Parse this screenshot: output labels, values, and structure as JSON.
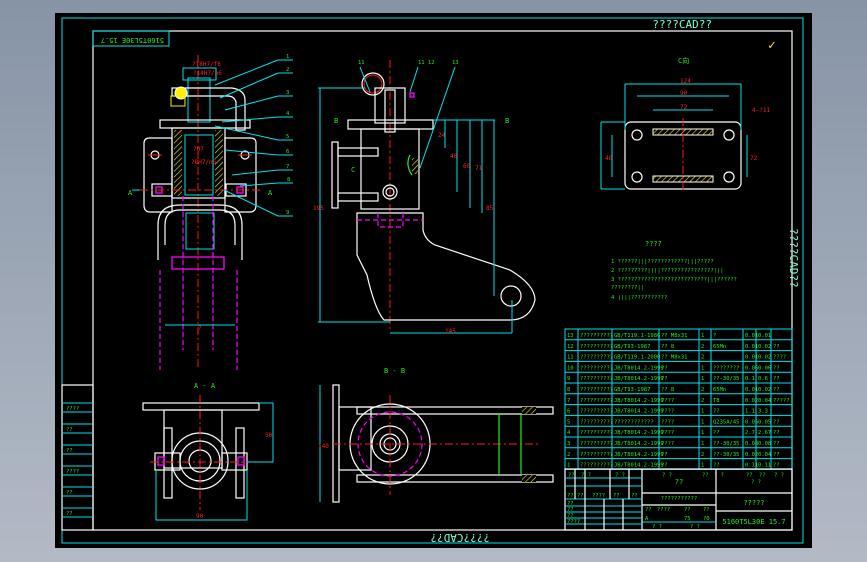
{
  "window": {
    "title_top": "????CAD??",
    "title_right": "????CAD??",
    "title_bottom": "????CAD??",
    "drawing_code_stamp": "5160T5L30E 15.7",
    "check_mark": "✓"
  },
  "colors": {
    "background": "#000000",
    "outer_border": "#00e5ee",
    "frame": "#ffffff",
    "text": "#22ee22",
    "dimension": "#ff2020",
    "hidden_line": "#ff00ff",
    "hatch": "#ffee00"
  },
  "views": {
    "main_callouts": [
      "1",
      "2",
      "3",
      "4",
      "5",
      "6",
      "7",
      "8",
      "9"
    ],
    "side_callouts": [
      "11",
      "11 12",
      "13"
    ],
    "section_a_label": "A - A",
    "section_b_label": "B - B",
    "view_c_label": "C向",
    "section_marks": {
      "a_left": "A",
      "a_right": "A",
      "b_left": "B",
      "b_right": "B"
    },
    "side_letter_c": "C",
    "dimensions_main": [
      "?18H7/f6",
      "?14H7/n6",
      "?H7",
      "?8H7/n6",
      "?"
    ],
    "dimensions_side": [
      "24",
      "40",
      "60",
      "71",
      "85",
      "145",
      "195"
    ],
    "dimensions_view_c": [
      "124",
      "90",
      "72",
      "4-?11",
      "40",
      "72"
    ],
    "dimensions_aa": [
      "90",
      "50"
    ],
    "dimensions_bb": [
      "140"
    ]
  },
  "notes": {
    "title": "????",
    "items": [
      "1 ??????|||????????????|||?????",
      "2 ?????????||||????????????????|||",
      "3 ???????????????????????????|||??????",
      "  ????????||",
      "4 ||||???????????"
    ]
  },
  "parts_table": {
    "rows": [
      [
        "13",
        "??????????",
        "GB/T119.1-1986",
        "?? M8x31",
        "1",
        "?",
        "0.01",
        "0.01",
        ""
      ],
      [
        "12",
        "??????????",
        "GB/T93-1987",
        "?? 8",
        "2",
        "65Mn",
        "0.01",
        "0.02",
        "??"
      ],
      [
        "11",
        "??????????",
        "GB/T119.1-2000",
        "?? M8x31",
        "2",
        "",
        "0.01",
        "0.02",
        "????"
      ],
      [
        "10",
        "??????????",
        "JB/T8014.2-1999",
        "??",
        "1",
        "????????",
        "0.06",
        "0.06",
        "??"
      ],
      [
        "9",
        "??????????",
        "JB/T8014.2-1999",
        "??",
        "1",
        "??-30/35",
        "0.1",
        "0.6",
        "??"
      ],
      [
        "8",
        "??????????",
        "GB/T93-1987",
        "?? 8",
        "2",
        "65Mn",
        "0.01",
        "0.02",
        "??"
      ],
      [
        "7",
        "??????????",
        "JB/T8014.2-1999",
        "????",
        "2",
        "T8",
        "0.02",
        "0.04",
        "?????"
      ],
      [
        "6",
        "??????????",
        "JB/T8014.2-1999",
        "????",
        "1",
        "??",
        "1.1",
        "3.3",
        ""
      ],
      [
        "5",
        "??????????",
        "????????????",
        "????",
        "1",
        "Q235A/45",
        "0.05",
        "0.05",
        "??"
      ],
      [
        "4",
        "??????????",
        "JB/T8014.2-1999",
        "????",
        "1",
        "??",
        "2.7",
        "2.67",
        "??"
      ],
      [
        "3",
        "??????????",
        "JB/T8014.2-1999",
        "????",
        "1",
        "??-30/35",
        "0.08",
        "0.08",
        "??"
      ],
      [
        "2",
        "??????????",
        "JB/T8014.2-1999",
        "??",
        "2",
        "??-30/35",
        "0.02",
        "0.04",
        "??"
      ],
      [
        "1",
        "??????????",
        "JB/T8014.2-1999",
        "??",
        "1",
        "??",
        "0.11",
        "0.11",
        "??"
      ]
    ],
    "header": [
      "??",
      "? ?",
      "? ?",
      "? ?",
      "??",
      "? ?",
      "??",
      "??",
      "? ?"
    ],
    "header_sub": "? ?"
  },
  "title_block": {
    "company": "??",
    "drawing_name": "???????????",
    "title": "?????",
    "drawing_number": "5160T5L30E 15.7",
    "labels": [
      "??",
      "??",
      "????",
      "??",
      "??"
    ],
    "approval": [
      "??",
      "??",
      "??",
      "????"
    ],
    "stage": [
      "??",
      "????",
      "??",
      "??"
    ],
    "scale_row": [
      "A",
      "75",
      "?0"
    ],
    "sheet": [
      "? ?",
      "? ?"
    ]
  },
  "left_stamp": {
    "items": [
      "????",
      "??",
      "??",
      "????",
      "??",
      "??"
    ]
  }
}
